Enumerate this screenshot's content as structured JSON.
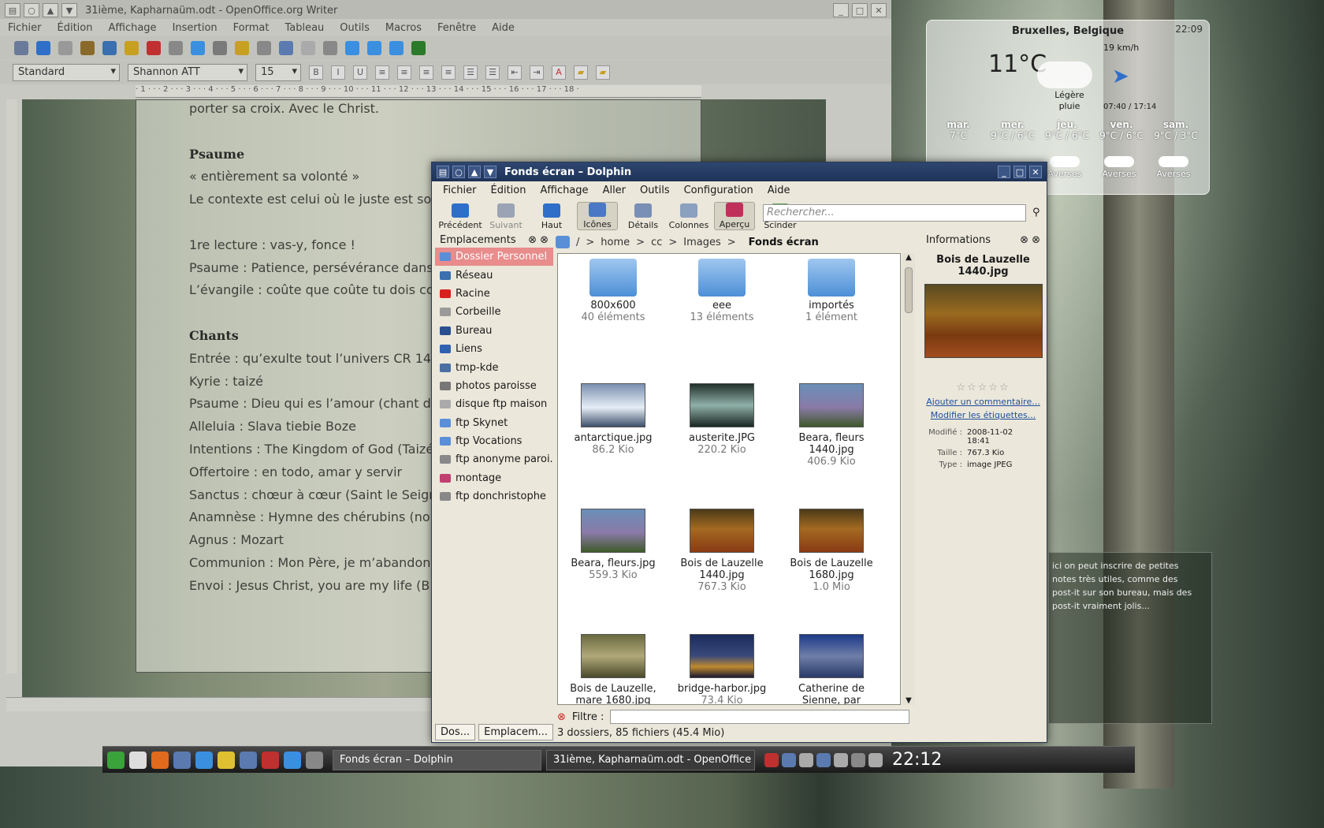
{
  "writer": {
    "title": "31ième, Kapharnaüm.odt - OpenOffice.org Writer",
    "menu": [
      "Fichier",
      "Édition",
      "Affichage",
      "Insertion",
      "Format",
      "Tableau",
      "Outils",
      "Macros",
      "Fenêtre",
      "Aide"
    ],
    "style": "Standard",
    "font": "Shannon ATT",
    "size": "15",
    "ruler": "· 1 · · · 2 · · · 3 · · · 4 · · · 5 · · · 6 · · · 7 · · · 8 · · · 9 · · · 10 · · · 11 · · · 12 · · · 13 · · · 14 · · · 15 · · · 16 · · · 17 · · · 18 ·",
    "doc": [
      {
        "t": "porter sa croix. Avec le Christ.",
        "k": "p"
      },
      {
        "t": "",
        "k": "b"
      },
      {
        "t": "Psaume",
        "k": "h"
      },
      {
        "t": "« entièrement sa volonté »",
        "k": "p"
      },
      {
        "t": "Le contexte est celui où le juste est souv",
        "k": "p"
      },
      {
        "t": "",
        "k": "b"
      },
      {
        "t": "1re lecture : vas-y, fonce !",
        "k": "p"
      },
      {
        "t": "Psaume : Patience, persévérance dans l",
        "k": "p"
      },
      {
        "t": "L’évangile : coûte que coûte tu dois con",
        "k": "p"
      },
      {
        "t": "",
        "k": "b"
      },
      {
        "t": "Chants",
        "k": "h"
      },
      {
        "t": "Entrée : qu’exulte tout l’univers CR 14-",
        "k": "p"
      },
      {
        "t": "Kyrie : taizé",
        "k": "p"
      },
      {
        "t": "Psaume : Dieu qui es l’amour (chant de",
        "k": "p"
      },
      {
        "t": "Alleluia : Slava tiebie Boze",
        "k": "p"
      },
      {
        "t": "Intentions : The Kingdom of God (Taizé",
        "k": "p"
      },
      {
        "t": "Offertoire : en todo, amar y servir",
        "k": "p"
      },
      {
        "t": "Sanctus : chœur à cœur (Saint le Seigne",
        "k": "p"
      },
      {
        "t": "Anamnèse : Hymne des chérubins (nou",
        "k": "p"
      },
      {
        "t": "Agnus : Mozart",
        "k": "p"
      },
      {
        "t": "Communion : Mon Père, je m’abandon",
        "k": "p"
      },
      {
        "t": "Envoi : Jesus Christ, you are my life (B 9",
        "k": "p"
      }
    ]
  },
  "dolphin": {
    "title": "Fonds écran – Dolphin",
    "menu": [
      "Fichier",
      "Édition",
      "Affichage",
      "Aller",
      "Outils",
      "Configuration",
      "Aide"
    ],
    "toolbar": [
      {
        "label": "Précédent",
        "icon": "back-arrow-icon",
        "state": "normal",
        "color": "#2f6fc9"
      },
      {
        "label": "Suivant",
        "icon": "forward-arrow-icon",
        "state": "dim",
        "color": "#9aa4b4"
      },
      {
        "label": "Haut",
        "icon": "up-arrow-icon",
        "state": "normal",
        "color": "#2f6fc9"
      },
      {
        "label": "Icônes",
        "icon": "icons-view-icon",
        "state": "on",
        "color": "#4a78c4"
      },
      {
        "label": "Détails",
        "icon": "details-view-icon",
        "state": "normal",
        "color": "#7a8fb5"
      },
      {
        "label": "Colonnes",
        "icon": "columns-view-icon",
        "state": "normal",
        "color": "#8ca0c0"
      },
      {
        "label": "Aperçu",
        "icon": "preview-icon",
        "state": "on",
        "color": "#c0305a"
      },
      {
        "label": "Scinder",
        "icon": "split-view-icon",
        "state": "normal",
        "color": "#5aa05a"
      }
    ],
    "search_placeholder": "Rechercher...",
    "places_title": "Emplacements",
    "places": [
      {
        "label": "Dossier Personnel",
        "color": "#5a8fd8",
        "sel": true
      },
      {
        "label": "Réseau",
        "color": "#3a6fb0"
      },
      {
        "label": "Racine",
        "color": "#d82020"
      },
      {
        "label": "Corbeille",
        "color": "#9a9a9a"
      },
      {
        "label": "Bureau",
        "color": "#2a4f90"
      },
      {
        "label": "Liens",
        "color": "#3060b0"
      },
      {
        "label": "tmp-kde",
        "color": "#4a6fa0"
      },
      {
        "label": "photos paroisse",
        "color": "#777"
      },
      {
        "label": "disque ftp maison",
        "color": "#aaa"
      },
      {
        "label": "ftp Skynet",
        "color": "#5a8fd8"
      },
      {
        "label": "ftp Vocations",
        "color": "#5a8fd8"
      },
      {
        "label": "ftp anonyme paroi...",
        "color": "#888"
      },
      {
        "label": "montage",
        "color": "#c04070"
      },
      {
        "label": "ftp donchristophe",
        "color": "#888"
      }
    ],
    "crumbs": [
      "/",
      "home",
      "cc",
      "Images"
    ],
    "crumb_current": "Fonds écran",
    "items": [
      {
        "name": "800x600",
        "sub": "40 éléments",
        "kind": "folder"
      },
      {
        "name": "eee",
        "sub": "13 éléments",
        "kind": "folder"
      },
      {
        "name": "importés",
        "sub": "1 élément",
        "kind": "folder"
      },
      {
        "name": "antarctique.jpg",
        "sub": "86.2 Kio",
        "kind": "img",
        "bg": "linear-gradient(#7a8fb0,#e6eef6 55%,#3d4f6a)"
      },
      {
        "name": "austerite.JPG",
        "sub": "220.2 Kio",
        "kind": "img",
        "bg": "linear-gradient(#22302a,#8fb0a8 50%,#1a2622)"
      },
      {
        "name": "Beara, fleurs\n1440.jpg",
        "sub": "406.9 Kio",
        "kind": "img",
        "bg": "linear-gradient(#6a8fb8,#8a7aa8 55%,#3f5a2a)"
      },
      {
        "name": "Beara, fleurs.jpg",
        "sub": "559.3 Kio",
        "kind": "img",
        "bg": "linear-gradient(#6a8fb8,#8a7aa8 55%,#3f5a2a)"
      },
      {
        "name": "Bois de Lauzelle\n1440.jpg",
        "sub": "767.3 Kio",
        "kind": "img",
        "bg": "linear-gradient(#4a3a18,#a36a22 45%,#8a3a14)"
      },
      {
        "name": "Bois de Lauzelle\n1680.jpg",
        "sub": "1.0 Mio",
        "kind": "img",
        "bg": "linear-gradient(#4a3a18,#a36a22 45%,#8a3a14)"
      },
      {
        "name": "Bois de Lauzelle,\nmare 1680.jpg",
        "sub": "",
        "kind": "img",
        "bg": "linear-gradient(#6a6a40,#b0a878 50%,#4a4a2a)"
      },
      {
        "name": "bridge-harbor.jpg",
        "sub": "73.4 Kio",
        "kind": "img",
        "bg": "linear-gradient(#1a2a5a,#3a4a7a 50%,#c08a30 75%,#1a1a30)"
      },
      {
        "name": "Catherine de\nSienne, par",
        "sub": "",
        "kind": "img",
        "bg": "linear-gradient(#1e3a8a,#6f7fa8 50%,#2a3a6a)"
      }
    ],
    "info_title": "Informations",
    "info_file": "Bois de Lauzelle\n1440.jpg",
    "info_links": [
      "Ajouter un commentaire...",
      "Modifier les étiquettes..."
    ],
    "meta": [
      {
        "k": "Modifié :",
        "v": "2008-11-02\n18:41"
      },
      {
        "k": "Taille :",
        "v": "767.3 Kio"
      },
      {
        "k": "Type :",
        "v": "image JPEG"
      }
    ],
    "filter_label": "Filtre :",
    "status": "3 dossiers, 85 fichiers (45.4 Mio)",
    "tabs": [
      "Dos...",
      "Emplacem..."
    ]
  },
  "weather": {
    "city": "Bruxelles, Belgique",
    "time": "22:09",
    "temp": "11°C",
    "wind": "19 km/h",
    "cond": "Légère\npluie",
    "sun": "07:40 / 17:14",
    "days": [
      {
        "d": "mar.",
        "t": "7°C"
      },
      {
        "d": "mer.",
        "t": "9°C / 6°C"
      },
      {
        "d": "jeu.",
        "t": "9°C / 6°C"
      },
      {
        "d": "ven.",
        "t": "9°C / 6°C"
      },
      {
        "d": "sam.",
        "t": "9°C / 3°C"
      }
    ],
    "showers": [
      "Averses",
      "Averses",
      "Averses"
    ]
  },
  "note": "ici on peut inscrire de petites notes très utiles, comme des post-it sur son bureau, mais des post-it vraiment jolis...",
  "taskbar": {
    "tasks": [
      "Fonds écran – Dolphin",
      "31ième, Kapharnaüm.odt - OpenOffice"
    ],
    "clock": "22:12",
    "launchers": [
      "#3aa33a",
      "#ddd",
      "#e06a1e",
      "#5a7ab0",
      "#3a8fe0",
      "#e0c030",
      "#5a7ab0",
      "#c03030",
      "#3a8fe0",
      "#888"
    ],
    "tray": [
      "#c03030",
      "#5a7ab0",
      "#aaa",
      "#5a7ab0",
      "#aaa",
      "#888",
      "#aaa"
    ]
  }
}
